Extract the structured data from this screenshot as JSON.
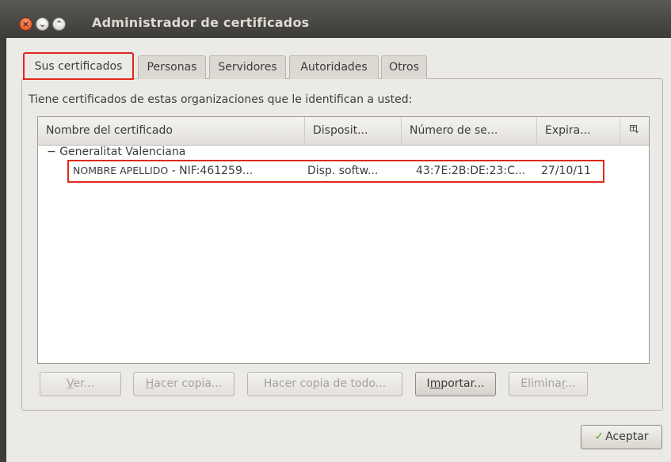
{
  "window": {
    "title": "Administrador de certificados",
    "close_glyph": "×",
    "min_glyph": "⌄",
    "max_glyph": "⌃"
  },
  "tabs": [
    {
      "label": "Sus certificados",
      "active": true
    },
    {
      "label": "Personas",
      "active": false
    },
    {
      "label": "Servidores",
      "active": false
    },
    {
      "label": "Autoridades",
      "active": false
    },
    {
      "label": "Otros",
      "active": false
    }
  ],
  "description": "Tiene certificados de estas organizaciones que le identifican a usted:",
  "table": {
    "columns": [
      "Nombre del certificado",
      "Disposit...",
      "Número de se...",
      "Expira..."
    ],
    "column_picker_icon": "column-picker-icon",
    "groups": [
      {
        "toggle": "−",
        "name": "Generalitat Valenciana",
        "rows": [
          {
            "name_prefix": "NOMBRE APELLIDO",
            "name_suffix": " - NIF:461259...",
            "device": "Disp. softw...",
            "serial": "43:7E:2B:DE:23:C...",
            "expires": "27/10/11"
          }
        ]
      }
    ]
  },
  "buttons": {
    "ver": {
      "mnemonic": "V",
      "rest": "er..."
    },
    "hacer_copia": {
      "mnemonic": "H",
      "rest": "acer copia..."
    },
    "hacer_copia_todo": {
      "label": "Hacer copia de todo..."
    },
    "importar": {
      "pre": "I",
      "mnemonic": "m",
      "rest": "portar..."
    },
    "eliminar": {
      "pre": "Elimina",
      "mnemonic": "r",
      "rest": "..."
    },
    "aceptar": {
      "label": "Aceptar",
      "icon": "checkmark-icon"
    }
  },
  "colors": {
    "highlight": "#e0281b",
    "titlebar": "#3d3c38",
    "background": "#eceae6"
  }
}
